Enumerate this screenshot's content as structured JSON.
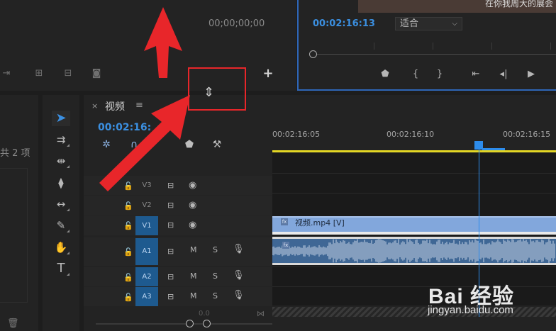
{
  "source_monitor": {
    "timecode": "00;00;00;00",
    "icons": [
      "insert-icon",
      "overwrite-icon",
      "export-frame-icon",
      "camera-icon",
      "add-icon"
    ]
  },
  "program_monitor": {
    "video_caption": "在你我周大的展会",
    "timecode": "00:02:16:13",
    "fit_label": "适合",
    "buttons": [
      "marker-icon",
      "in-point-icon",
      "out-point-icon",
      "go-to-in-icon",
      "step-back-icon",
      "play-icon"
    ]
  },
  "project": {
    "item_count": "共 2 项"
  },
  "timeline": {
    "sequence_name": "视频",
    "close": "×",
    "menu": "≡",
    "timecode": "00:02:16:",
    "ruler_labels": [
      "00:02:16:05",
      "00:02:16:10",
      "00:02:16:15"
    ],
    "tracks": [
      {
        "name": "V3",
        "on": false,
        "type": "video"
      },
      {
        "name": "V2",
        "on": false,
        "type": "video"
      },
      {
        "name": "V1",
        "on": true,
        "type": "video"
      },
      {
        "name": "A1",
        "on": true,
        "type": "audio"
      },
      {
        "name": "A2",
        "on": true,
        "type": "audio"
      },
      {
        "name": "A3",
        "on": true,
        "type": "audio"
      }
    ],
    "track_mute_label": "M",
    "track_solo_label": "S",
    "video_clip_name": "视频.mp4 [V]",
    "fx_label": "fx",
    "zoom_label": "0.0",
    "playhead_fraction": 0.73
  },
  "watermark": {
    "brand": "Bai 经验",
    "url": "jingyan.baidu.com"
  },
  "colors": {
    "accent_blue": "#2d8ceb",
    "work_area_yellow": "#e3d624",
    "annotation_red": "#e8262a",
    "video_clip": "#82a7dc",
    "audio_clip": "#3f6795"
  }
}
